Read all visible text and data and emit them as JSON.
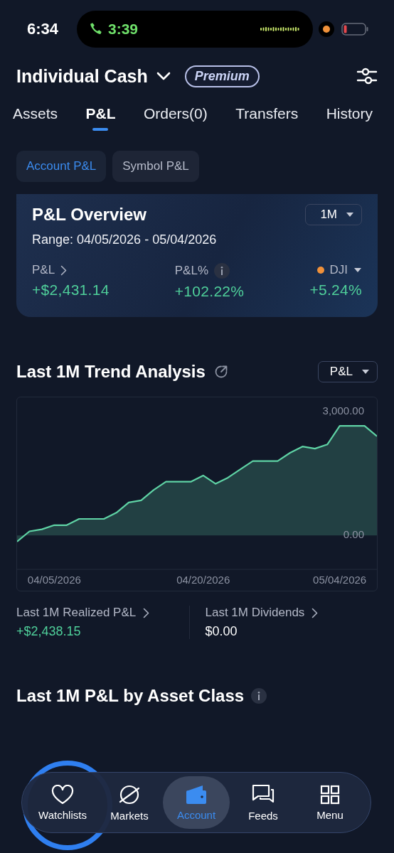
{
  "status_bar": {
    "time": "6:34",
    "call_time": "3:39"
  },
  "header": {
    "account": "Individual Cash",
    "badge": "Premium"
  },
  "tabs": [
    {
      "label": "Assets",
      "selected": false
    },
    {
      "label": "P&L",
      "selected": true
    },
    {
      "label": "Orders(0)",
      "selected": false
    },
    {
      "label": "Transfers",
      "selected": false
    },
    {
      "label": "History",
      "selected": false
    }
  ],
  "segments": [
    {
      "label": "Account P&L",
      "selected": true
    },
    {
      "label": "Symbol P&L",
      "selected": false
    }
  ],
  "overview": {
    "title": "P&L Overview",
    "period": "1M",
    "range": "Range: 04/05/2026 - 05/04/2026",
    "metrics": [
      {
        "kind": "link",
        "label": "P&L",
        "value": "+$2,431.14"
      },
      {
        "kind": "info",
        "label": "P&L%",
        "value": "+102.22%"
      },
      {
        "kind": "benchmark",
        "label": "DJI",
        "value": "+5.24%"
      }
    ]
  },
  "trend": {
    "title": "Last 1M Trend Analysis",
    "selector": "P&L",
    "chart_data": {
      "type": "area",
      "categories": [
        null,
        null,
        null,
        "04/05/2026",
        null,
        null,
        null,
        null,
        null,
        null,
        null,
        null,
        null,
        null,
        null,
        "04/20/2026",
        null,
        null,
        null,
        null,
        null,
        null,
        null,
        null,
        null,
        null,
        "05/04/2026",
        null,
        null,
        null
      ],
      "series": [
        {
          "color": "#5fd3a5",
          "values": [
            -150,
            100,
            150,
            250,
            250,
            400,
            400,
            400,
            550,
            800,
            850,
            1100,
            1300,
            1300,
            1300,
            1450,
            1250,
            1400,
            1600,
            1800,
            1800,
            1800,
            2000,
            2150,
            2100,
            2200,
            2650,
            2650,
            2650,
            2400
          ]
        }
      ],
      "ylim": [
        -820,
        3340
      ],
      "yticks": [
        {
          "value": 3000,
          "label": "3,000.00"
        },
        {
          "value": 0,
          "label": "0.00"
        }
      ]
    }
  },
  "summary": [
    {
      "kind": "gain",
      "label": "Last 1M Realized P&L",
      "value": "+$2,438.15"
    },
    {
      "kind": "neutral",
      "label": "Last 1M Dividends",
      "value": "$0.00"
    }
  ],
  "asset_class": {
    "title": "Last 1M P&L by Asset Class"
  },
  "nav": [
    {
      "kind": "heart",
      "label": "Watchlists",
      "selected": false
    },
    {
      "kind": "planet",
      "label": "Markets",
      "selected": false
    },
    {
      "kind": "wallet",
      "label": "Account",
      "selected": true
    },
    {
      "kind": "chat",
      "label": "Feeds",
      "selected": false
    },
    {
      "kind": "grid",
      "label": "Menu",
      "selected": false
    }
  ]
}
